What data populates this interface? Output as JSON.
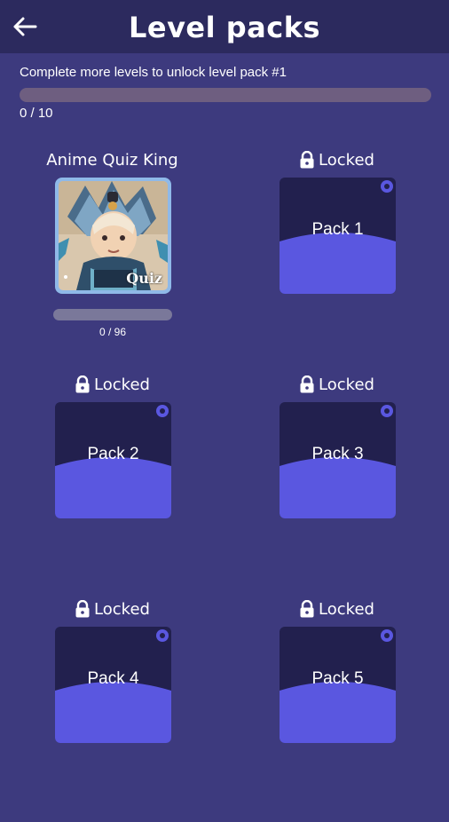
{
  "header": {
    "title": "Level packs",
    "back_icon": "back-arrow-icon"
  },
  "unlock": {
    "message": "Complete more levels to unlock level pack #1",
    "progress_text": "0 / 10",
    "progress_fraction": 0
  },
  "colors": {
    "background": "#3d3a7e",
    "header": "#2c2a5e",
    "pack_dark": "#22204e",
    "pack_accent": "#5a57e0",
    "progress_track": "#6e5e80"
  },
  "packs": [
    {
      "label": "Anime Quiz King",
      "locked": false,
      "art_text": "Quiz",
      "progress_text": "0 / 96",
      "progress_fraction": 0
    },
    {
      "label": "Locked",
      "name": "Pack 1",
      "locked": true,
      "icon": "lock-icon"
    },
    {
      "label": "Locked",
      "name": "Pack 2",
      "locked": true,
      "icon": "lock-icon"
    },
    {
      "label": "Locked",
      "name": "Pack 3",
      "locked": true,
      "icon": "lock-icon"
    },
    {
      "label": "Locked",
      "name": "Pack 4",
      "locked": true,
      "icon": "lock-icon"
    },
    {
      "label": "Locked",
      "name": "Pack 5",
      "locked": true,
      "icon": "lock-icon"
    }
  ]
}
